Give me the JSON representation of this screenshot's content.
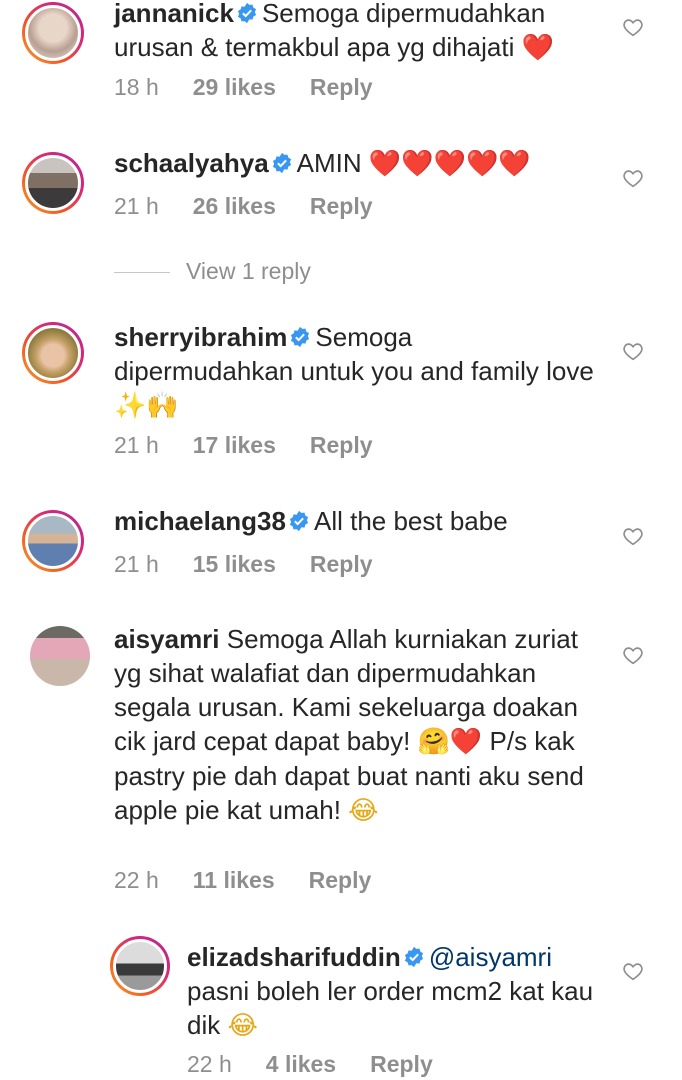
{
  "comments": [
    {
      "username": "jannanick",
      "verified": true,
      "text": "Semoga dipermudahkan urusan & termakbul apa yg dihajati",
      "emoji": "❤️",
      "time": "18 h",
      "likes": "29 likes",
      "reply": "Reply"
    },
    {
      "username": "schaalyahya",
      "verified": true,
      "text": "AMIN",
      "emoji": "❤️❤️❤️❤️❤️",
      "time": "21 h",
      "likes": "26 likes",
      "reply": "Reply",
      "view_replies": "View 1 reply"
    },
    {
      "username": "sherryibrahim",
      "verified": true,
      "text": "Semoga dipermudahkan untuk you and family love",
      "emoji": "✨🙌",
      "time": "21 h",
      "likes": "17 likes",
      "reply": "Reply"
    },
    {
      "username": "michaelang38",
      "verified": true,
      "text": "All the best babe",
      "time": "21 h",
      "likes": "15 likes",
      "reply": "Reply"
    },
    {
      "username": "aisyamri",
      "verified": false,
      "text_part1": "Semoga Allah kurniakan zuriat yg sihat walafiat dan dipermudahkan segala urusan. Kami sekeluarga  doakan cik jard cepat dapat baby!",
      "emoji1": "🤗❤️",
      "text_part2": "P/s kak pastry pie dah dapat buat nanti aku send apple pie kat umah!",
      "emoji2": "😂",
      "time": "22 h",
      "likes": "11 likes",
      "reply": "Reply"
    },
    {
      "username": "elizadsharifuddin",
      "verified": true,
      "mention": "@aisyamri",
      "text": "pasni boleh ler order mcm2 kat kau dik",
      "emoji": "😂",
      "time": "22 h",
      "likes": "4 likes",
      "reply": "Reply"
    }
  ],
  "icons": {
    "verified": "verified-badge-icon",
    "like": "heart-outline-icon"
  },
  "colors": {
    "verified": "#3897f0",
    "text": "#262626",
    "meta": "#8e8e8e",
    "mention": "#00376b"
  }
}
